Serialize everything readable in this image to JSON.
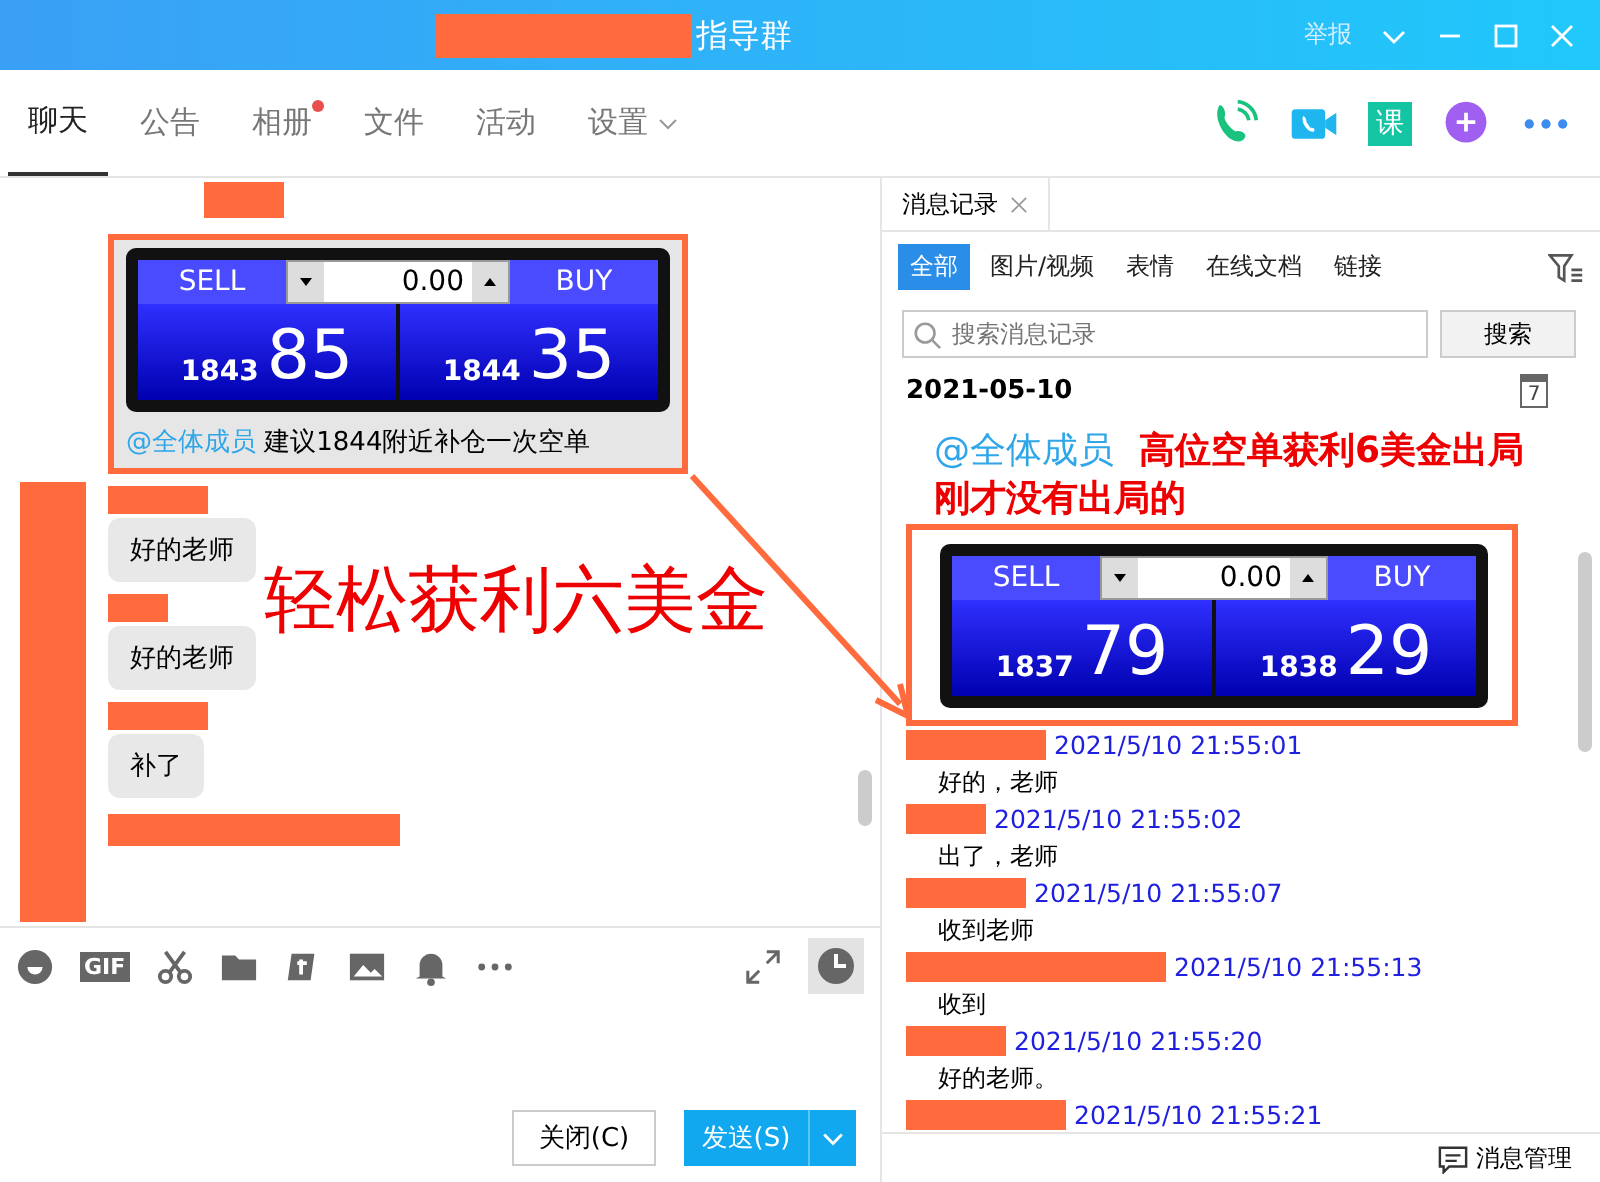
{
  "window": {
    "title": "指导群",
    "report": "举报"
  },
  "tabs": [
    {
      "label": "聊天",
      "selected": true,
      "dot": false,
      "dropdown": false
    },
    {
      "label": "公告",
      "selected": false,
      "dot": false,
      "dropdown": false
    },
    {
      "label": "相册",
      "selected": false,
      "dot": true,
      "dropdown": false
    },
    {
      "label": "文件",
      "selected": false,
      "dot": false,
      "dropdown": false
    },
    {
      "label": "活动",
      "selected": false,
      "dot": false,
      "dropdown": false
    },
    {
      "label": "设置",
      "selected": false,
      "dot": false,
      "dropdown": true
    }
  ],
  "course_icon": "课",
  "chat": {
    "first_message": {
      "widget": {
        "sell": "SELL",
        "buy": "BUY",
        "volume": "0.00",
        "sell_small": "1843",
        "sell_big": "85",
        "buy_small": "1844",
        "buy_big": "35"
      },
      "mention": "@全体成员",
      "text": "建议1844附近补仓一次空单"
    },
    "bubbles": [
      "好的老师",
      "好的老师",
      "补了"
    ],
    "annotation": "轻松获利六美金"
  },
  "toolbar": {
    "gif": "GIF"
  },
  "buttons": {
    "close": "关闭(C)",
    "send": "发送(S)"
  },
  "history": {
    "title": "消息记录",
    "filters": [
      {
        "label": "全部",
        "selected": true
      },
      {
        "label": "图片/视频",
        "selected": false
      },
      {
        "label": "表情",
        "selected": false
      },
      {
        "label": "在线文档",
        "selected": false
      },
      {
        "label": "链接",
        "selected": false
      }
    ],
    "search": {
      "placeholder": "搜索消息记录",
      "button": "搜索"
    },
    "date": "2021-05-10",
    "calendar_day": "7",
    "post": {
      "mention": "@全体成员",
      "text": "高位空单获利6美金出局刚才没有出局的",
      "widget": {
        "sell": "SELL",
        "buy": "BUY",
        "volume": "0.00",
        "sell_small": "1837",
        "sell_big": "79",
        "buy_small": "1838",
        "buy_big": "29"
      }
    },
    "messages": [
      {
        "time": "2021/5/10 21:55:01",
        "text": "好的，老师"
      },
      {
        "time": "2021/5/10 21:55:02",
        "text": "出了，老师"
      },
      {
        "time": "2021/5/10 21:55:07",
        "text": "收到老师"
      },
      {
        "time": "2021/5/10 21:55:13",
        "text": "收到"
      },
      {
        "time": "2021/5/10 21:55:20",
        "text": "好的老师。"
      },
      {
        "time": "2021/5/10 21:55:21"
      }
    ],
    "manage": "消息管理"
  }
}
